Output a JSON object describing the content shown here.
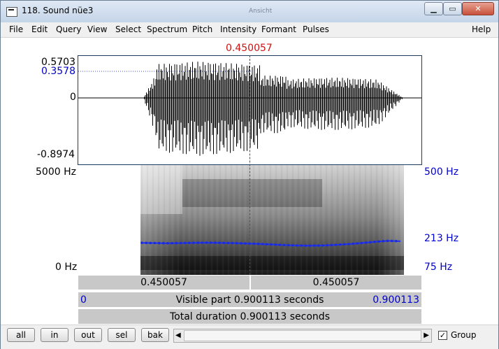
{
  "window": {
    "title": "118. Sound nüe3",
    "ghost_title": "Ansicht",
    "minimize": "▁",
    "maximize": "▭",
    "close": "✕"
  },
  "menu": [
    "File",
    "Edit",
    "Query",
    "View",
    "Select",
    "Spectrum",
    "Pitch",
    "Intensity",
    "Formant",
    "Pulses",
    "Help"
  ],
  "editor": {
    "cursor_time": "0.450057",
    "wave": {
      "max": "0.5703",
      "marker": "0.3578",
      "zero": "0",
      "min": "-0.8974"
    },
    "spectrogram": {
      "top": "5000 Hz",
      "bottom": "0 Hz"
    },
    "pitch": {
      "top": "500 Hz",
      "mid": "213 Hz",
      "bottom": "75 Hz"
    },
    "segment_left": "0.450057",
    "segment_right": "0.450057",
    "visible_start": "0",
    "visible_label": "Visible part 0.900113 seconds",
    "visible_end": "0.900113",
    "total_label": "Total duration 0.900113 seconds"
  },
  "bottom": {
    "buttons": [
      "all",
      "in",
      "out",
      "sel",
      "bak"
    ],
    "group_label": "Group",
    "group_checked": "✓"
  },
  "colors": {
    "accent_red": "#d11111",
    "accent_blue": "#0000cc",
    "pitch_line": "#2233ee"
  },
  "pitch_curve_hz": [
    213,
    212,
    211,
    212,
    213,
    214,
    213,
    212,
    210,
    208,
    205,
    202,
    200,
    199,
    200,
    203,
    207,
    212,
    218,
    223,
    221
  ]
}
